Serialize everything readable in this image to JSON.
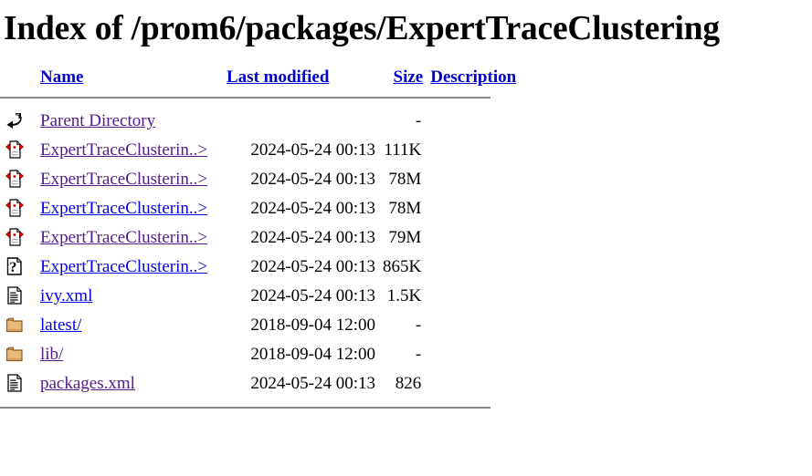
{
  "page": {
    "title": "Index of /prom6/packages/ExpertTraceClustering"
  },
  "table": {
    "headers": {
      "name": "Name",
      "last_modified": "Last modified",
      "size": "Size",
      "description": "Description"
    },
    "header_link_color": "#0000cc",
    "link_colors": {
      "unvisited": "#0000ee",
      "visited": "#551a8b"
    },
    "rows": [
      {
        "icon": "parent-directory-icon",
        "name": "Parent Directory",
        "link_state": "visited",
        "last_modified": "",
        "size": "-",
        "description": ""
      },
      {
        "icon": "compressed-archive-icon",
        "name": "ExpertTraceClusterin..>",
        "link_state": "visited",
        "last_modified": "2024-05-24 00:13",
        "size": "111K",
        "description": ""
      },
      {
        "icon": "compressed-archive-icon",
        "name": "ExpertTraceClusterin..>",
        "link_state": "visited",
        "last_modified": "2024-05-24 00:13",
        "size": "78M",
        "description": ""
      },
      {
        "icon": "compressed-archive-icon",
        "name": "ExpertTraceClusterin..>",
        "link_state": "unvisited",
        "last_modified": "2024-05-24 00:13",
        "size": "78M",
        "description": ""
      },
      {
        "icon": "compressed-archive-icon",
        "name": "ExpertTraceClusterin..>",
        "link_state": "visited",
        "last_modified": "2024-05-24 00:13",
        "size": "79M",
        "description": ""
      },
      {
        "icon": "unknown-file-icon",
        "name": "ExpertTraceClusterin..>",
        "link_state": "unvisited",
        "last_modified": "2024-05-24 00:13",
        "size": "865K",
        "description": ""
      },
      {
        "icon": "text-document-icon",
        "name": "ivy.xml",
        "link_state": "unvisited",
        "last_modified": "2024-05-24 00:13",
        "size": "1.5K",
        "description": ""
      },
      {
        "icon": "folder-icon",
        "name": "latest/",
        "link_state": "unvisited",
        "last_modified": "2018-09-04 12:00",
        "size": "-",
        "description": ""
      },
      {
        "icon": "folder-icon",
        "name": "lib/",
        "link_state": "visited",
        "last_modified": "2018-09-04 12:00",
        "size": "-",
        "description": ""
      },
      {
        "icon": "text-document-icon",
        "name": "packages.xml",
        "link_state": "visited",
        "last_modified": "2024-05-24 00:13",
        "size": "826",
        "description": ""
      }
    ]
  }
}
